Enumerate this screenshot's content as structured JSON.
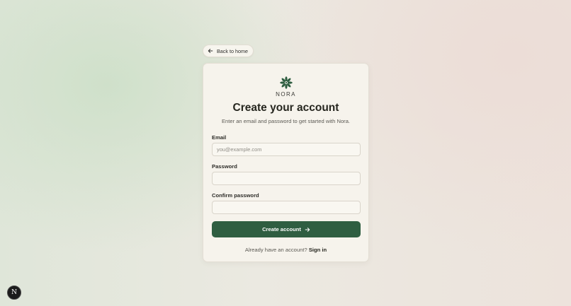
{
  "back_link": {
    "label": "Back to home",
    "icon": "arrow-left-icon"
  },
  "brand": {
    "name": "NORA",
    "logo_icon": "flower-icon",
    "logo_color": "#2f5e41"
  },
  "header": {
    "title": "Create your account",
    "subtitle": "Enter an email and password to get started with Nora."
  },
  "form": {
    "email": {
      "label": "Email",
      "placeholder": "you@example.com",
      "value": ""
    },
    "password": {
      "label": "Password",
      "placeholder": "",
      "value": ""
    },
    "confirm_password": {
      "label": "Confirm password",
      "placeholder": "",
      "value": ""
    },
    "submit": {
      "label": "Create account",
      "icon": "arrow-right-icon",
      "color": "#2f5e41"
    }
  },
  "footer": {
    "prompt": "Already have an account?",
    "link": "Sign in"
  },
  "dev_badge": {
    "letter": "N"
  }
}
